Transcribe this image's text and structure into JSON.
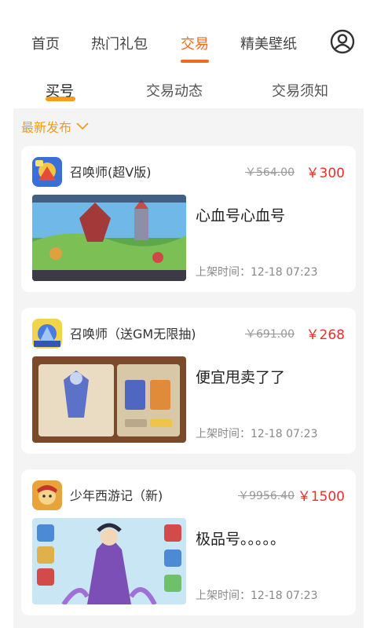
{
  "top_nav": {
    "tabs": [
      {
        "label": "首页",
        "active": false
      },
      {
        "label": "热门礼包",
        "active": false
      },
      {
        "label": "交易",
        "active": true
      },
      {
        "label": "精美壁纸",
        "active": false
      }
    ],
    "profile_icon": "user-circle-icon",
    "accent_color": "#f26a21"
  },
  "sub_nav": {
    "tabs": [
      {
        "label": "买号",
        "active": true
      },
      {
        "label": "交易动态",
        "active": false
      },
      {
        "label": "交易须知",
        "active": false
      }
    ],
    "underline_color": "#f59d1a"
  },
  "filter": {
    "label": "最新发布",
    "icon": "chevron-down-icon",
    "color": "#f29c19"
  },
  "listings": [
    {
      "game_name": "召唤师(超V版)",
      "original_price": "￥564.00",
      "price": "￥300",
      "description": "心血号心血号",
      "listed_time": "上架时间：12-18 07:23",
      "icon": "summoner-game-icon"
    },
    {
      "game_name": "召唤师（送GM无限抽)",
      "original_price": "￥691.00",
      "price": "￥268",
      "description": "便宜甩卖了了",
      "listed_time": "上架时间：12-18 07:23",
      "icon": "summoner-gm-game-icon"
    },
    {
      "game_name": "少年西游记（新)",
      "original_price": "￥9956.40",
      "price": "￥1500",
      "description": "极品号。。。。。",
      "listed_time": "上架时间：12-18 07:23",
      "icon": "journey-west-game-icon"
    }
  ],
  "colors": {
    "price": "#e5322d",
    "background": "#f4f4f4"
  }
}
